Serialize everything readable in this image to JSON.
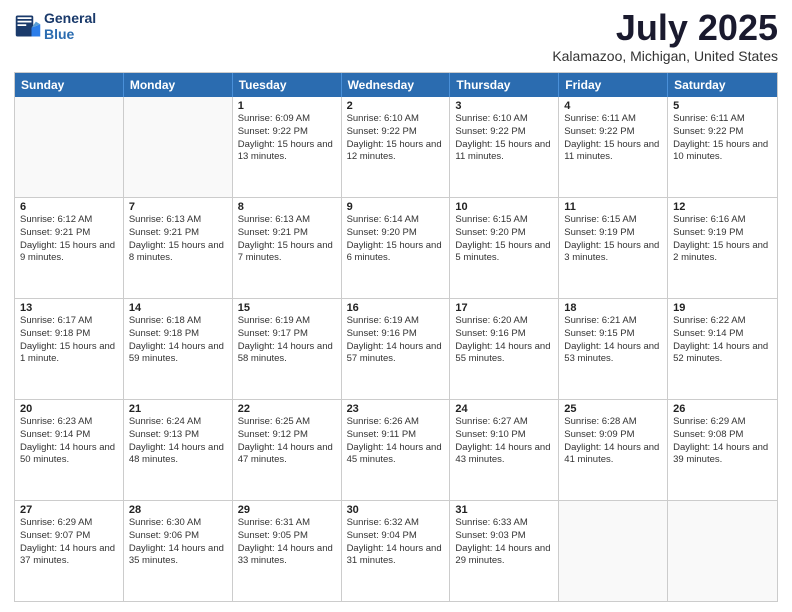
{
  "header": {
    "logo_line1": "General",
    "logo_line2": "Blue",
    "month": "July 2025",
    "location": "Kalamazoo, Michigan, United States"
  },
  "days_of_week": [
    "Sunday",
    "Monday",
    "Tuesday",
    "Wednesday",
    "Thursday",
    "Friday",
    "Saturday"
  ],
  "weeks": [
    [
      {
        "day": "",
        "sunrise": "",
        "sunset": "",
        "daylight": "",
        "empty": true
      },
      {
        "day": "",
        "sunrise": "",
        "sunset": "",
        "daylight": "",
        "empty": true
      },
      {
        "day": "1",
        "sunrise": "Sunrise: 6:09 AM",
        "sunset": "Sunset: 9:22 PM",
        "daylight": "Daylight: 15 hours and 13 minutes.",
        "empty": false
      },
      {
        "day": "2",
        "sunrise": "Sunrise: 6:10 AM",
        "sunset": "Sunset: 9:22 PM",
        "daylight": "Daylight: 15 hours and 12 minutes.",
        "empty": false
      },
      {
        "day": "3",
        "sunrise": "Sunrise: 6:10 AM",
        "sunset": "Sunset: 9:22 PM",
        "daylight": "Daylight: 15 hours and 11 minutes.",
        "empty": false
      },
      {
        "day": "4",
        "sunrise": "Sunrise: 6:11 AM",
        "sunset": "Sunset: 9:22 PM",
        "daylight": "Daylight: 15 hours and 11 minutes.",
        "empty": false
      },
      {
        "day": "5",
        "sunrise": "Sunrise: 6:11 AM",
        "sunset": "Sunset: 9:22 PM",
        "daylight": "Daylight: 15 hours and 10 minutes.",
        "empty": false
      }
    ],
    [
      {
        "day": "6",
        "sunrise": "Sunrise: 6:12 AM",
        "sunset": "Sunset: 9:21 PM",
        "daylight": "Daylight: 15 hours and 9 minutes.",
        "empty": false
      },
      {
        "day": "7",
        "sunrise": "Sunrise: 6:13 AM",
        "sunset": "Sunset: 9:21 PM",
        "daylight": "Daylight: 15 hours and 8 minutes.",
        "empty": false
      },
      {
        "day": "8",
        "sunrise": "Sunrise: 6:13 AM",
        "sunset": "Sunset: 9:21 PM",
        "daylight": "Daylight: 15 hours and 7 minutes.",
        "empty": false
      },
      {
        "day": "9",
        "sunrise": "Sunrise: 6:14 AM",
        "sunset": "Sunset: 9:20 PM",
        "daylight": "Daylight: 15 hours and 6 minutes.",
        "empty": false
      },
      {
        "day": "10",
        "sunrise": "Sunrise: 6:15 AM",
        "sunset": "Sunset: 9:20 PM",
        "daylight": "Daylight: 15 hours and 5 minutes.",
        "empty": false
      },
      {
        "day": "11",
        "sunrise": "Sunrise: 6:15 AM",
        "sunset": "Sunset: 9:19 PM",
        "daylight": "Daylight: 15 hours and 3 minutes.",
        "empty": false
      },
      {
        "day": "12",
        "sunrise": "Sunrise: 6:16 AM",
        "sunset": "Sunset: 9:19 PM",
        "daylight": "Daylight: 15 hours and 2 minutes.",
        "empty": false
      }
    ],
    [
      {
        "day": "13",
        "sunrise": "Sunrise: 6:17 AM",
        "sunset": "Sunset: 9:18 PM",
        "daylight": "Daylight: 15 hours and 1 minute.",
        "empty": false
      },
      {
        "day": "14",
        "sunrise": "Sunrise: 6:18 AM",
        "sunset": "Sunset: 9:18 PM",
        "daylight": "Daylight: 14 hours and 59 minutes.",
        "empty": false
      },
      {
        "day": "15",
        "sunrise": "Sunrise: 6:19 AM",
        "sunset": "Sunset: 9:17 PM",
        "daylight": "Daylight: 14 hours and 58 minutes.",
        "empty": false
      },
      {
        "day": "16",
        "sunrise": "Sunrise: 6:19 AM",
        "sunset": "Sunset: 9:16 PM",
        "daylight": "Daylight: 14 hours and 57 minutes.",
        "empty": false
      },
      {
        "day": "17",
        "sunrise": "Sunrise: 6:20 AM",
        "sunset": "Sunset: 9:16 PM",
        "daylight": "Daylight: 14 hours and 55 minutes.",
        "empty": false
      },
      {
        "day": "18",
        "sunrise": "Sunrise: 6:21 AM",
        "sunset": "Sunset: 9:15 PM",
        "daylight": "Daylight: 14 hours and 53 minutes.",
        "empty": false
      },
      {
        "day": "19",
        "sunrise": "Sunrise: 6:22 AM",
        "sunset": "Sunset: 9:14 PM",
        "daylight": "Daylight: 14 hours and 52 minutes.",
        "empty": false
      }
    ],
    [
      {
        "day": "20",
        "sunrise": "Sunrise: 6:23 AM",
        "sunset": "Sunset: 9:14 PM",
        "daylight": "Daylight: 14 hours and 50 minutes.",
        "empty": false
      },
      {
        "day": "21",
        "sunrise": "Sunrise: 6:24 AM",
        "sunset": "Sunset: 9:13 PM",
        "daylight": "Daylight: 14 hours and 48 minutes.",
        "empty": false
      },
      {
        "day": "22",
        "sunrise": "Sunrise: 6:25 AM",
        "sunset": "Sunset: 9:12 PM",
        "daylight": "Daylight: 14 hours and 47 minutes.",
        "empty": false
      },
      {
        "day": "23",
        "sunrise": "Sunrise: 6:26 AM",
        "sunset": "Sunset: 9:11 PM",
        "daylight": "Daylight: 14 hours and 45 minutes.",
        "empty": false
      },
      {
        "day": "24",
        "sunrise": "Sunrise: 6:27 AM",
        "sunset": "Sunset: 9:10 PM",
        "daylight": "Daylight: 14 hours and 43 minutes.",
        "empty": false
      },
      {
        "day": "25",
        "sunrise": "Sunrise: 6:28 AM",
        "sunset": "Sunset: 9:09 PM",
        "daylight": "Daylight: 14 hours and 41 minutes.",
        "empty": false
      },
      {
        "day": "26",
        "sunrise": "Sunrise: 6:29 AM",
        "sunset": "Sunset: 9:08 PM",
        "daylight": "Daylight: 14 hours and 39 minutes.",
        "empty": false
      }
    ],
    [
      {
        "day": "27",
        "sunrise": "Sunrise: 6:29 AM",
        "sunset": "Sunset: 9:07 PM",
        "daylight": "Daylight: 14 hours and 37 minutes.",
        "empty": false
      },
      {
        "day": "28",
        "sunrise": "Sunrise: 6:30 AM",
        "sunset": "Sunset: 9:06 PM",
        "daylight": "Daylight: 14 hours and 35 minutes.",
        "empty": false
      },
      {
        "day": "29",
        "sunrise": "Sunrise: 6:31 AM",
        "sunset": "Sunset: 9:05 PM",
        "daylight": "Daylight: 14 hours and 33 minutes.",
        "empty": false
      },
      {
        "day": "30",
        "sunrise": "Sunrise: 6:32 AM",
        "sunset": "Sunset: 9:04 PM",
        "daylight": "Daylight: 14 hours and 31 minutes.",
        "empty": false
      },
      {
        "day": "31",
        "sunrise": "Sunrise: 6:33 AM",
        "sunset": "Sunset: 9:03 PM",
        "daylight": "Daylight: 14 hours and 29 minutes.",
        "empty": false
      },
      {
        "day": "",
        "sunrise": "",
        "sunset": "",
        "daylight": "",
        "empty": true
      },
      {
        "day": "",
        "sunrise": "",
        "sunset": "",
        "daylight": "",
        "empty": true
      }
    ]
  ]
}
